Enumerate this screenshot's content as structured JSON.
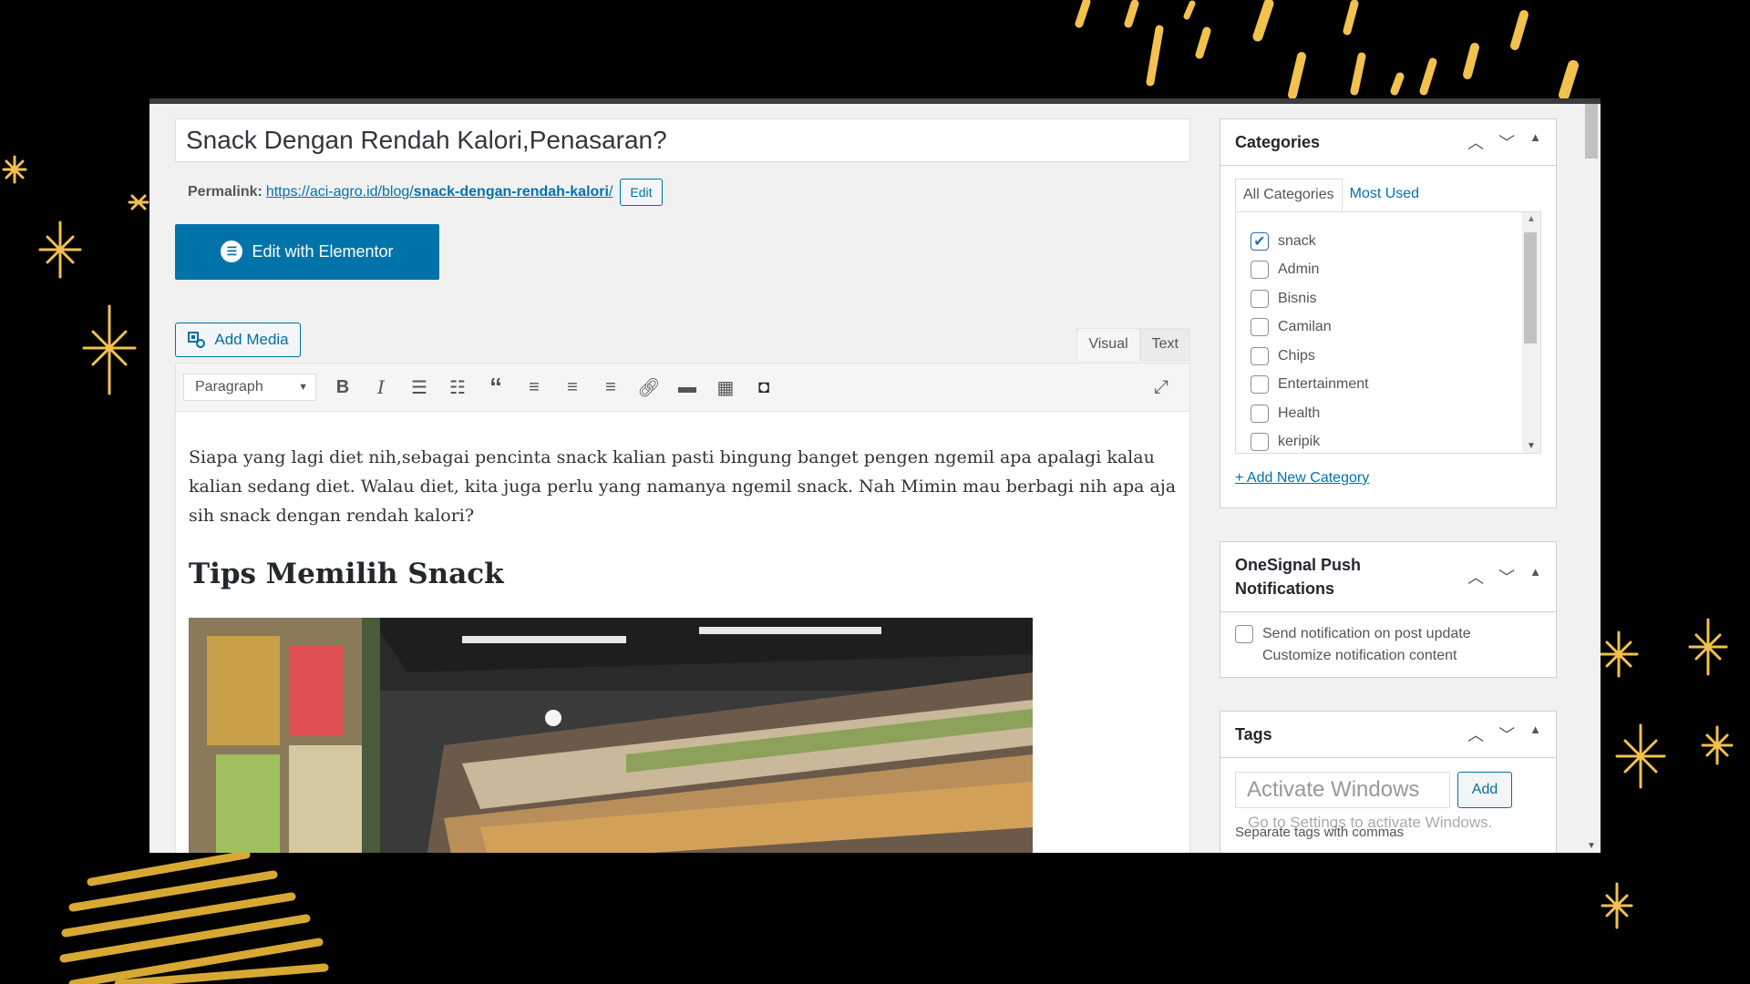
{
  "post": {
    "title": "Snack Dengan Rendah Kalori,Penasaran?",
    "permalink_label": "Permalink:",
    "permalink_url_prefix": "https://aci-agro.id/blog/",
    "permalink_slug": "snack-dengan-rendah-kalori",
    "permalink_url_suffix": "/",
    "edit_label": "Edit"
  },
  "elementor": {
    "label": "Edit with Elementor",
    "icon": "elementor-icon"
  },
  "editor": {
    "add_media_label": "Add Media",
    "tabs": {
      "visual": "Visual",
      "text": "Text"
    },
    "format_select": "Paragraph",
    "paragraph": "Siapa yang lagi diet nih,sebagai pencinta snack kalian pasti bingung banget pengen ngemil apa apalagi kalau kalian sedang diet. Walau diet, kita juga perlu yang namanya ngemil snack. Nah Mimin mau berbagi nih apa aja sih snack dengan rendah kalori?",
    "heading": "Tips Memilih Snack"
  },
  "categories": {
    "title": "Categories",
    "tab_all": "All Categories",
    "tab_most_used": "Most Used",
    "items": [
      {
        "label": "snack",
        "checked": true
      },
      {
        "label": "Admin",
        "checked": false
      },
      {
        "label": "Bisnis",
        "checked": false
      },
      {
        "label": "Camilan",
        "checked": false
      },
      {
        "label": "Chips",
        "checked": false
      },
      {
        "label": "Entertainment",
        "checked": false
      },
      {
        "label": "Health",
        "checked": false
      },
      {
        "label": "keripik",
        "checked": false
      }
    ],
    "add_new": "+ Add New Category"
  },
  "onesignal": {
    "title_line1": "OneSignal Push",
    "title_line2": "Notifications",
    "send_label": "Send notification on post update",
    "customize_label": "Customize notification content"
  },
  "tags": {
    "title": "Tags",
    "add_label": "Add",
    "watermark": "Activate Windows",
    "watermark_sub": "Go to Settings to activate Windows.",
    "hint": "Separate tags with commas"
  },
  "colors": {
    "primary": "#0073aa",
    "gold": "#f2c14e",
    "background": "#000000"
  }
}
